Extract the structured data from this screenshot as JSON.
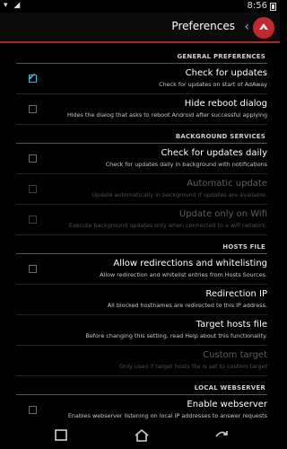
{
  "status_bar": {
    "time": "8:56",
    "icons": "▾ ◢"
  },
  "action_bar": {
    "title": "Preferences",
    "icons": {
      "back": "chevron-icon",
      "logo": "adaway-logo-icon"
    }
  },
  "categories": {
    "general": "GENERAL PREFERENCES",
    "background": "BACKGROUND SERVICES",
    "hosts": "HOSTS FILE",
    "webserver": "LOCAL WEBSERVER"
  },
  "prefs": {
    "check_updates": {
      "title": "Check for updates",
      "summary": "Check for updates on start of AdAway",
      "checked": true
    },
    "hide_reboot": {
      "title": "Hide reboot dialog",
      "summary": "Hides the dialog that asks to reboot Android after successful applying",
      "checked": false
    },
    "update_daily": {
      "title": "Check for updates daily",
      "summary": "Check for updates daily in background with notifications",
      "checked": false
    },
    "auto_update": {
      "title": "Automatic update",
      "summary": "Update automatically in background if updates are available.",
      "checked": false,
      "enabled": false
    },
    "wifi_only": {
      "title": "Update only on Wifi",
      "summary": "Execute background updates only when connected to a wifi network.",
      "checked": false,
      "enabled": false
    },
    "allow_redirects": {
      "title": "Allow redirections and whitelisting",
      "summary": "Allow redirection and whitelist entries from Hosts Sources.",
      "checked": false
    },
    "redirection_ip": {
      "title": "Redirection IP",
      "summary": "All blocked hostnames are redirected to this IP address."
    },
    "target_hosts": {
      "title": "Target hosts file",
      "summary": "Before changing this setting, read Help about this functionality."
    },
    "custom_target": {
      "title": "Custom target",
      "summary": "Only used if target hosts file is set to custom target",
      "enabled": false
    },
    "enable_webserver": {
      "title": "Enable webserver",
      "summary": "Enables webserver listening on local IP addresses to answer requests",
      "checked": false
    }
  },
  "nav_bar": {
    "icons": {
      "back": "nav-back-icon",
      "home": "nav-home-icon",
      "recent": "nav-recent-apps-icon"
    }
  },
  "colors": {
    "accent": "#b3242a",
    "checkbox_checked": "#33b5e5",
    "background": "#000000"
  }
}
